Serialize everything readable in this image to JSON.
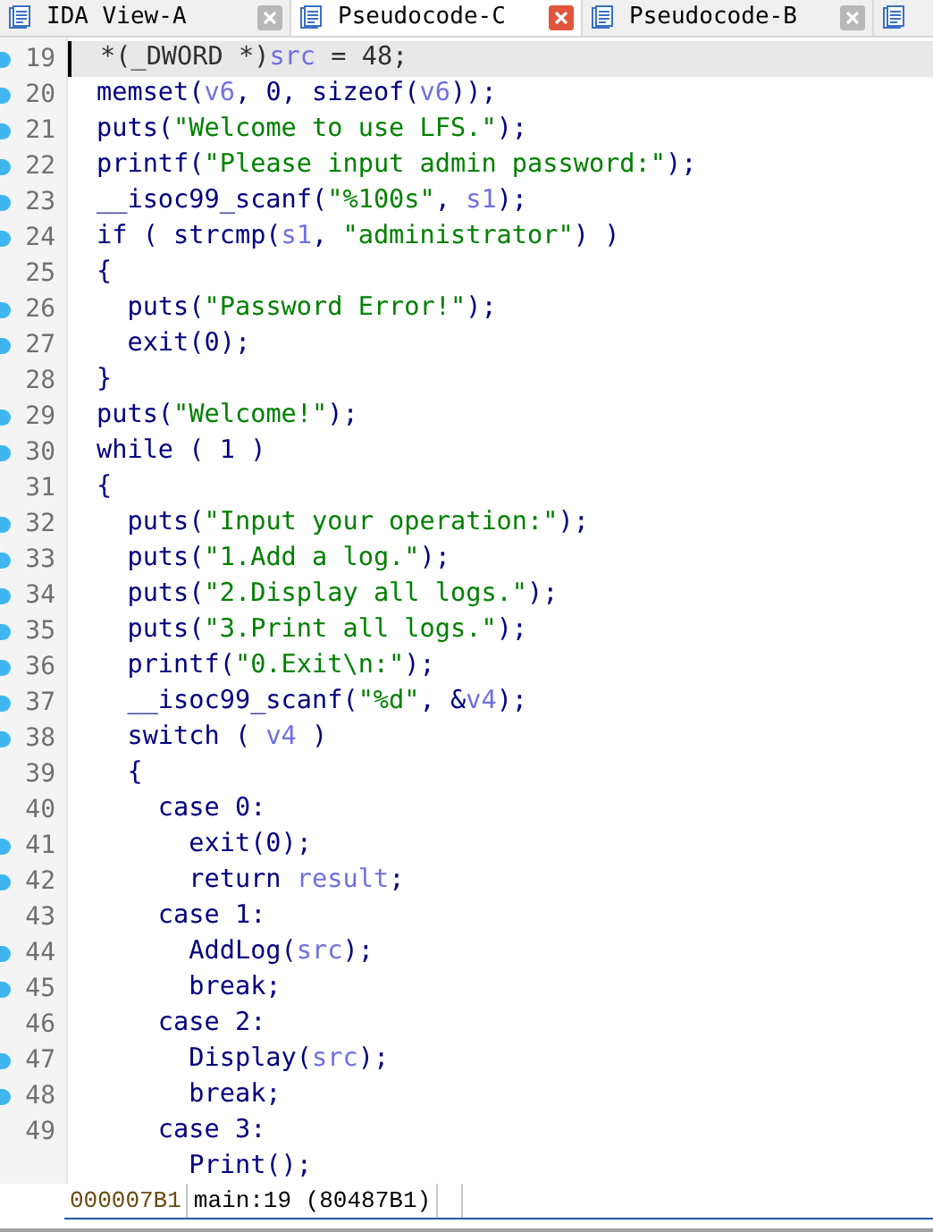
{
  "tabs": [
    {
      "label": "IDA View-A",
      "selected": false
    },
    {
      "label": "Pseudocode-C",
      "selected": true
    },
    {
      "label": "Pseudocode-B",
      "selected": false
    }
  ],
  "lines": [
    {
      "number": "19",
      "breakpoint": true,
      "current": true,
      "segments": [
        {
          "kind": "plain",
          "text": "*(_DWORD *)"
        },
        {
          "kind": "var",
          "text": "src"
        },
        {
          "kind": "plain",
          "text": " = 48;"
        }
      ]
    },
    {
      "number": "20",
      "breakpoint": true,
      "current": false,
      "segments": [
        {
          "kind": "code",
          "text": "memset("
        },
        {
          "kind": "var",
          "text": "v6"
        },
        {
          "kind": "code",
          "text": ", 0, sizeof("
        },
        {
          "kind": "var",
          "text": "v6"
        },
        {
          "kind": "code",
          "text": "));"
        }
      ]
    },
    {
      "number": "21",
      "breakpoint": true,
      "current": false,
      "segments": [
        {
          "kind": "code",
          "text": "puts("
        },
        {
          "kind": "str",
          "text": "\"Welcome to use LFS.\""
        },
        {
          "kind": "code",
          "text": ");"
        }
      ]
    },
    {
      "number": "22",
      "breakpoint": true,
      "current": false,
      "segments": [
        {
          "kind": "code",
          "text": "printf("
        },
        {
          "kind": "str",
          "text": "\"Please input admin password:\""
        },
        {
          "kind": "code",
          "text": ");"
        }
      ]
    },
    {
      "number": "23",
      "breakpoint": true,
      "current": false,
      "segments": [
        {
          "kind": "code",
          "text": "__isoc99_scanf("
        },
        {
          "kind": "str",
          "text": "\"%100s\""
        },
        {
          "kind": "code",
          "text": ", "
        },
        {
          "kind": "var",
          "text": "s1"
        },
        {
          "kind": "code",
          "text": ");"
        }
      ]
    },
    {
      "number": "24",
      "breakpoint": true,
      "current": false,
      "segments": [
        {
          "kind": "code",
          "text": "if ( strcmp("
        },
        {
          "kind": "var",
          "text": "s1"
        },
        {
          "kind": "code",
          "text": ", "
        },
        {
          "kind": "str",
          "text": "\"administrator\""
        },
        {
          "kind": "code",
          "text": ") )"
        }
      ]
    },
    {
      "number": "25",
      "breakpoint": false,
      "current": false,
      "segments": [
        {
          "kind": "code",
          "text": "{"
        }
      ]
    },
    {
      "number": "26",
      "breakpoint": true,
      "current": false,
      "segments": [
        {
          "kind": "code",
          "text": "  puts("
        },
        {
          "kind": "str",
          "text": "\"Password Error!\""
        },
        {
          "kind": "code",
          "text": ");"
        }
      ]
    },
    {
      "number": "27",
      "breakpoint": true,
      "current": false,
      "segments": [
        {
          "kind": "code",
          "text": "  exit(0);"
        }
      ]
    },
    {
      "number": "28",
      "breakpoint": false,
      "current": false,
      "segments": [
        {
          "kind": "code",
          "text": "}"
        }
      ]
    },
    {
      "number": "29",
      "breakpoint": true,
      "current": false,
      "segments": [
        {
          "kind": "code",
          "text": "puts("
        },
        {
          "kind": "str",
          "text": "\"Welcome!\""
        },
        {
          "kind": "code",
          "text": ");"
        }
      ]
    },
    {
      "number": "30",
      "breakpoint": true,
      "current": false,
      "segments": [
        {
          "kind": "code",
          "text": "while ( 1 )"
        }
      ]
    },
    {
      "number": "31",
      "breakpoint": false,
      "current": false,
      "segments": [
        {
          "kind": "code",
          "text": "{"
        }
      ]
    },
    {
      "number": "32",
      "breakpoint": true,
      "current": false,
      "segments": [
        {
          "kind": "code",
          "text": "  puts("
        },
        {
          "kind": "str",
          "text": "\"Input your operation:\""
        },
        {
          "kind": "code",
          "text": ");"
        }
      ]
    },
    {
      "number": "33",
      "breakpoint": true,
      "current": false,
      "segments": [
        {
          "kind": "code",
          "text": "  puts("
        },
        {
          "kind": "str",
          "text": "\"1.Add a log.\""
        },
        {
          "kind": "code",
          "text": ");"
        }
      ]
    },
    {
      "number": "34",
      "breakpoint": true,
      "current": false,
      "segments": [
        {
          "kind": "code",
          "text": "  puts("
        },
        {
          "kind": "str",
          "text": "\"2.Display all logs.\""
        },
        {
          "kind": "code",
          "text": ");"
        }
      ]
    },
    {
      "number": "35",
      "breakpoint": true,
      "current": false,
      "segments": [
        {
          "kind": "code",
          "text": "  puts("
        },
        {
          "kind": "str",
          "text": "\"3.Print all logs.\""
        },
        {
          "kind": "code",
          "text": ");"
        }
      ]
    },
    {
      "number": "36",
      "breakpoint": true,
      "current": false,
      "segments": [
        {
          "kind": "code",
          "text": "  printf("
        },
        {
          "kind": "str",
          "text": "\"0.Exit\\n:\""
        },
        {
          "kind": "code",
          "text": ");"
        }
      ]
    },
    {
      "number": "37",
      "breakpoint": true,
      "current": false,
      "segments": [
        {
          "kind": "code",
          "text": "  __isoc99_scanf("
        },
        {
          "kind": "str",
          "text": "\"%d\""
        },
        {
          "kind": "code",
          "text": ", &"
        },
        {
          "kind": "var",
          "text": "v4"
        },
        {
          "kind": "code",
          "text": ");"
        }
      ]
    },
    {
      "number": "38",
      "breakpoint": true,
      "current": false,
      "segments": [
        {
          "kind": "code",
          "text": "  switch ( "
        },
        {
          "kind": "var",
          "text": "v4"
        },
        {
          "kind": "code",
          "text": " )"
        }
      ]
    },
    {
      "number": "39",
      "breakpoint": false,
      "current": false,
      "segments": [
        {
          "kind": "code",
          "text": "  {"
        }
      ]
    },
    {
      "number": "40",
      "breakpoint": false,
      "current": false,
      "segments": [
        {
          "kind": "code",
          "text": "    case 0:"
        }
      ]
    },
    {
      "number": "41",
      "breakpoint": true,
      "current": false,
      "segments": [
        {
          "kind": "code",
          "text": "      exit(0);"
        }
      ]
    },
    {
      "number": "42",
      "breakpoint": true,
      "current": false,
      "segments": [
        {
          "kind": "code",
          "text": "      return "
        },
        {
          "kind": "var",
          "text": "result"
        },
        {
          "kind": "code",
          "text": ";"
        }
      ]
    },
    {
      "number": "43",
      "breakpoint": false,
      "current": false,
      "segments": [
        {
          "kind": "code",
          "text": "    case 1:"
        }
      ]
    },
    {
      "number": "44",
      "breakpoint": true,
      "current": false,
      "segments": [
        {
          "kind": "code",
          "text": "      AddLog("
        },
        {
          "kind": "var",
          "text": "src"
        },
        {
          "kind": "code",
          "text": ");"
        }
      ]
    },
    {
      "number": "45",
      "breakpoint": true,
      "current": false,
      "segments": [
        {
          "kind": "code",
          "text": "      break;"
        }
      ]
    },
    {
      "number": "46",
      "breakpoint": false,
      "current": false,
      "segments": [
        {
          "kind": "code",
          "text": "    case 2:"
        }
      ]
    },
    {
      "number": "47",
      "breakpoint": true,
      "current": false,
      "segments": [
        {
          "kind": "code",
          "text": "      Display("
        },
        {
          "kind": "var",
          "text": "src"
        },
        {
          "kind": "code",
          "text": ");"
        }
      ]
    },
    {
      "number": "48",
      "breakpoint": true,
      "current": false,
      "segments": [
        {
          "kind": "code",
          "text": "      break;"
        }
      ]
    },
    {
      "number": "49",
      "breakpoint": false,
      "current": false,
      "segments": [
        {
          "kind": "code",
          "text": "    case 3:"
        }
      ]
    },
    {
      "breakpoint": false,
      "current": false,
      "segments": [
        {
          "kind": "code",
          "text": "      Print();"
        }
      ]
    }
  ],
  "status_bar": {
    "offset": "000007B1",
    "location": "main:19 (80487B1)"
  }
}
